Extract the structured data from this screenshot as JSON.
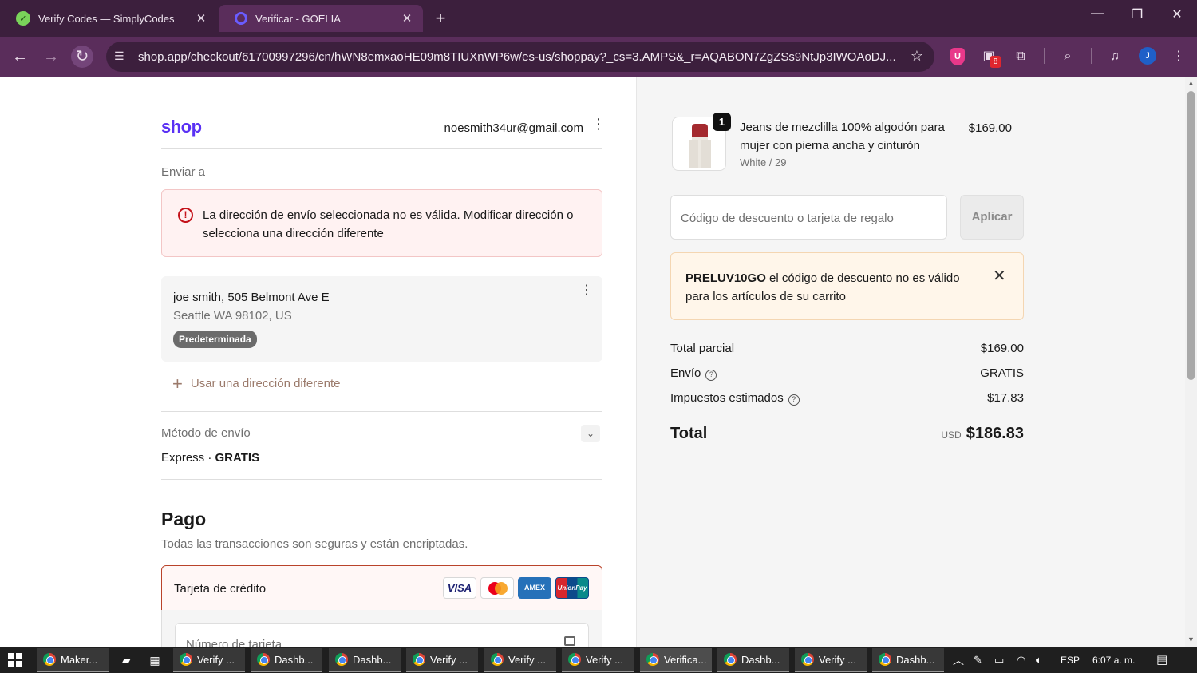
{
  "browser": {
    "tabs": [
      {
        "title": "Verify Codes — SimplyCodes",
        "close": "✕"
      },
      {
        "title": "Verificar - GOELIA",
        "close": "✕"
      }
    ],
    "new_tab": "+",
    "url": "shop.app/checkout/61700997296/cn/hWN8emxaoHE09m8TIUXnWP6w/es-us/shoppay?_cs=3.AMPS&_r=AQABON7ZgZSs9NtJp3IWOAoDJ...",
    "ext_badge": "8",
    "profile_initial": "J"
  },
  "header": {
    "logo": "shop",
    "email": "noesmith34ur@gmail.com"
  },
  "shipping": {
    "send_to_label": "Enviar a",
    "alert_text": "La dirección de envío seleccionada no es válida. ",
    "alert_link": "Modificar dirección",
    "alert_tail": " o selecciona una dirección diferente",
    "address_line1": "joe smith, 505 Belmont Ave E",
    "address_line2": "Seattle WA 98102, US",
    "default_badge": "Predeterminada",
    "use_different": "Usar una dirección diferente",
    "method_label": "Método de envío",
    "method_name": "Express · ",
    "method_price": "GRATIS"
  },
  "payment": {
    "title": "Pago",
    "subtitle": "Todas las transacciones son seguras y están encriptadas.",
    "credit_card_label": "Tarjeta de crédito",
    "card_brands": [
      "VISA",
      "",
      "AMEX",
      "UnionPay"
    ],
    "card_number_placeholder": "Número de tarjeta"
  },
  "order": {
    "item_qty": "1",
    "item_name": "Jeans de mezclilla 100% algodón para mujer con pierna ancha y cinturón",
    "item_variant": "White / 29",
    "item_price": "$169.00",
    "discount_placeholder": "Código de descuento o tarjeta de regalo",
    "apply_label": "Aplicar",
    "discount_code": "PRELUV10GO",
    "discount_error": " el código de descuento no es válido para los artículos de su carrito",
    "subtotal_label": "Total parcial",
    "subtotal_value": "$169.00",
    "shipping_label": "Envío",
    "shipping_value": "GRATIS",
    "taxes_label": "Impuestos estimados",
    "taxes_value": "$17.83",
    "total_label": "Total",
    "total_currency": "USD",
    "total_value": "$186.83"
  },
  "taskbar": {
    "apps": [
      "Maker...",
      "Verify ...",
      "Dashb...",
      "Dashb...",
      "Verify ...",
      "Verify ...",
      "Verify ...",
      "Verifica...",
      "Dashb...",
      "Verify ...",
      "Dashb..."
    ],
    "language": "ESP",
    "time": "6:07 a. m."
  },
  "colors": {
    "shop_brand": "#5a31f4",
    "error_border": "#f3c6c6",
    "warning_bg": "#fff6ea",
    "chrome_tabbar": "#3c1f3d"
  }
}
